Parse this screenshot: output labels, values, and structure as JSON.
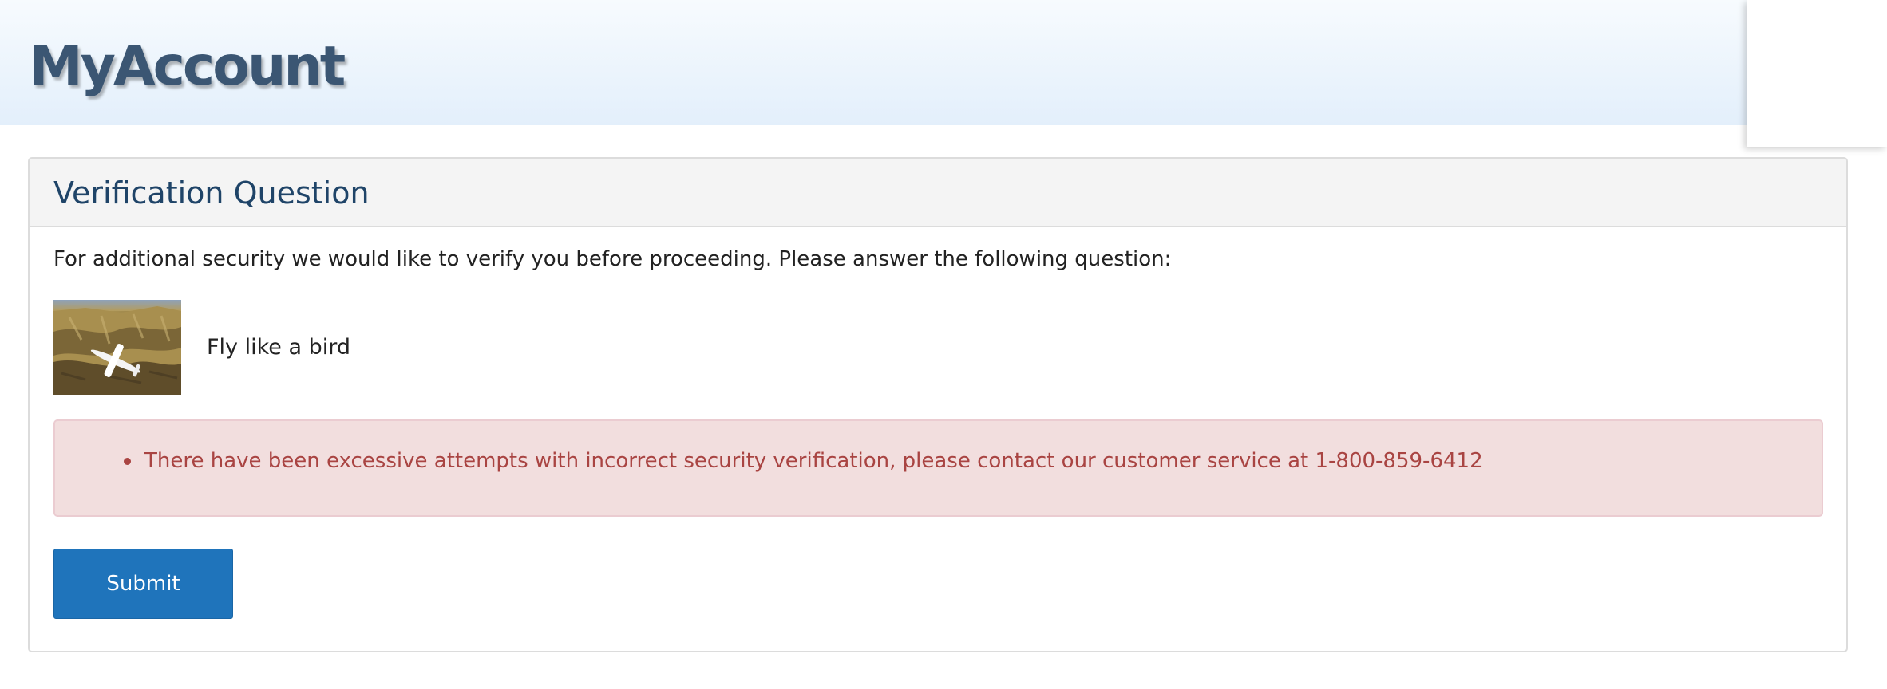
{
  "header": {
    "logo_text": "MyAccount"
  },
  "panel": {
    "title": "Verification Question",
    "intro": "For additional security we would like to verify you before proceeding. Please answer the following question:",
    "question": {
      "image_icon": "airplane-over-canyon-image",
      "text": "Fly like a bird"
    },
    "alert": {
      "messages": [
        "There have been excessive attempts with incorrect security verification, please contact our customer service at 1-800-859-6412"
      ],
      "colors": {
        "text": "#a94442",
        "background": "#f2dede",
        "border": "#ebccd1"
      }
    },
    "submit_label": "Submit"
  },
  "colors": {
    "accent": "#1f74bb",
    "title": "#1f4468",
    "logo": "#3b5673"
  }
}
